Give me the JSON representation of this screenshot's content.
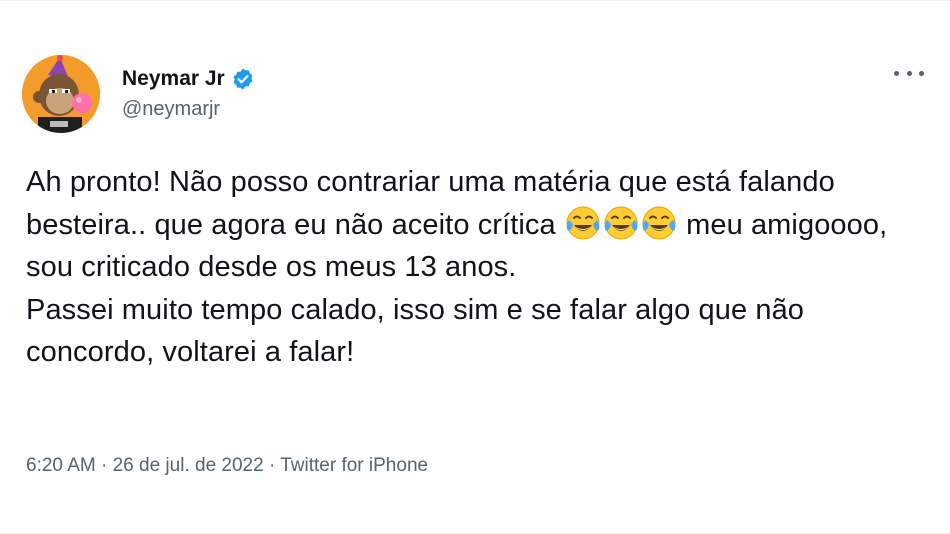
{
  "author": {
    "display_name": "Neymar Jr",
    "handle": "@neymarjr",
    "verified": true,
    "avatar_icon": "ape-avatar-icon",
    "avatar_bg": "#f39c2b"
  },
  "menu": {
    "icon": "more-options-icon"
  },
  "tweet": {
    "line1_pre": "Ah pronto! Não posso contrariar uma matéria que está falando besteira.. que agora eu não aceito crítica ",
    "emoji_icon": "tears-of-joy-emoji-icon",
    "line1_post": " meu amigoooo, sou criticado desde os meus 13 anos.",
    "line2": "Passei muito tempo calado, isso sim e se falar algo que não concordo, voltarei a falar!"
  },
  "meta": {
    "time": "6:20 AM",
    "separator": " · ",
    "date": "26 de jul. de 2022",
    "source": "Twitter for iPhone"
  },
  "colors": {
    "text": "#0f1419",
    "secondary": "#536471",
    "verified_blue": "#1d9bf0"
  }
}
